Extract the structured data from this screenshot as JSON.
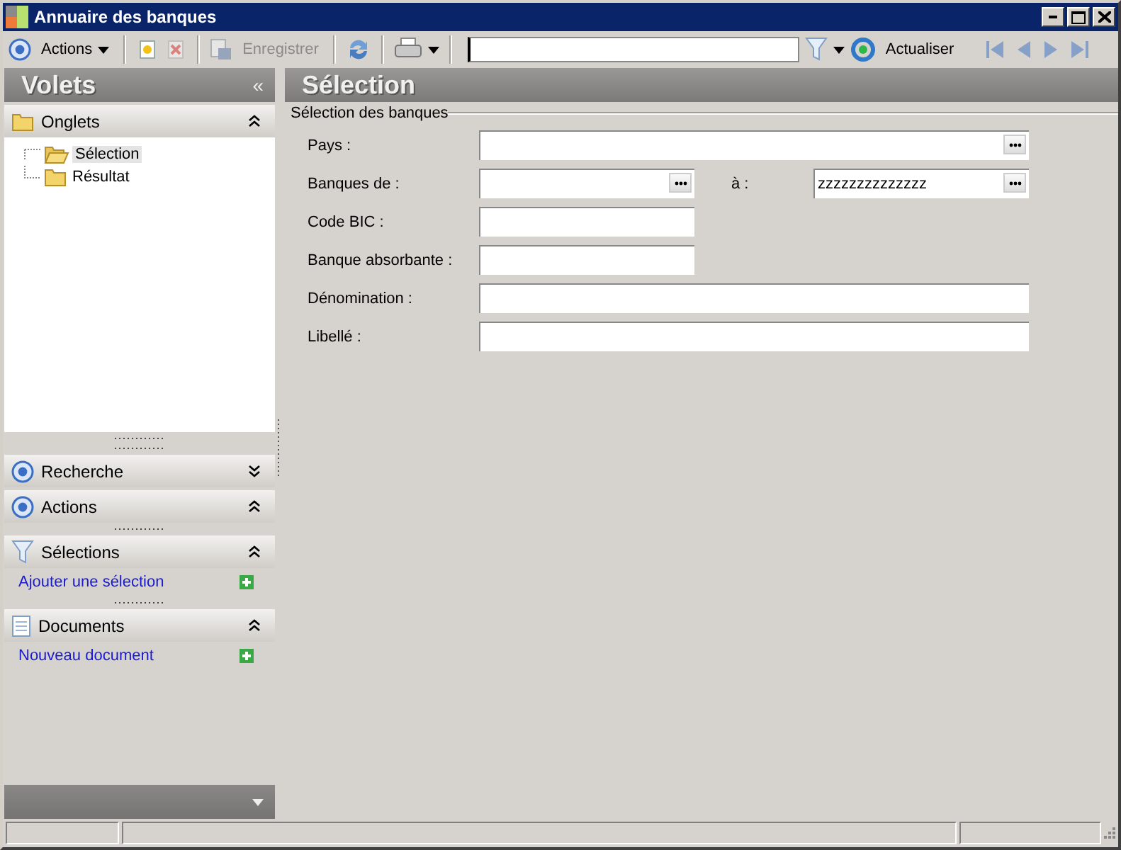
{
  "window": {
    "title": "Annuaire des banques"
  },
  "toolbar": [
    {
      "kind": "menu",
      "label": "Actions",
      "disabled": false
    },
    {
      "kind": "new",
      "disabled": false
    },
    {
      "kind": "delete",
      "disabled": true
    },
    {
      "kind": "save",
      "label": "Enregistrer",
      "disabled": true
    },
    {
      "kind": "sync",
      "disabled": false
    },
    {
      "kind": "print",
      "disabled": false
    },
    {
      "kind": "search"
    },
    {
      "kind": "filter",
      "disabled": false
    },
    {
      "kind": "reload",
      "label": "Actualiser",
      "disabled": false
    },
    {
      "kind": "first",
      "disabled": true
    },
    {
      "kind": "prev",
      "disabled": true
    },
    {
      "kind": "next",
      "disabled": true
    },
    {
      "kind": "last",
      "disabled": true
    }
  ],
  "sidebar": {
    "title": "Volets",
    "collapse": "«",
    "sections": [
      {
        "title": "Onglets",
        "expanded": true,
        "tree": [
          {
            "label": "Sélection",
            "selected": true
          },
          {
            "label": "Résultat",
            "selected": false
          }
        ]
      },
      {
        "title": "Recherche",
        "expanded": false
      },
      {
        "title": "Actions",
        "expanded": true
      },
      {
        "title": "Sélections",
        "expanded": true,
        "link": "Ajouter une sélection"
      },
      {
        "title": "Documents",
        "expanded": true,
        "link": "Nouveau document"
      }
    ]
  },
  "main": {
    "title": "Sélection",
    "group": "Sélection des banques",
    "rows": [
      {
        "fields": [
          {
            "label": "Pays :",
            "browse": true
          }
        ]
      },
      {
        "fields": [
          {
            "label": "Banques de :",
            "browse": true
          },
          {
            "label": "à :",
            "value": "zzzzzzzzzzzzzz",
            "browse": true
          }
        ]
      },
      {
        "fields": [
          {
            "label": "Code BIC :",
            "browse": false
          }
        ]
      },
      {
        "fields": [
          {
            "label": "Banque absorbante :",
            "browse": false
          }
        ]
      },
      {
        "fields": [
          {
            "label": "Dénomination :",
            "browse": false
          }
        ]
      },
      {
        "fields": [
          {
            "label": "Libellé :",
            "browse": false
          }
        ]
      }
    ]
  }
}
